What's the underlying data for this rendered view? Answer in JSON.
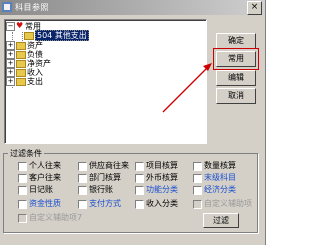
{
  "window": {
    "title": "科目参照",
    "close_glyph": "×"
  },
  "tree": {
    "root": "常用",
    "selected": "504 其他支出",
    "items": [
      "资产",
      "负债",
      "净资产",
      "收入",
      "支出"
    ]
  },
  "buttons": {
    "ok": "确定",
    "common": "常用",
    "edit": "编辑",
    "cancel": "取消"
  },
  "filter": {
    "title": "过滤条件",
    "row1": [
      "个人往来",
      "供应商往来",
      "项目核算",
      "数量核算"
    ],
    "row2": [
      "客户往来",
      "部门核算",
      "外币核算",
      "末级科目"
    ],
    "row3": [
      "日记账",
      "银行账",
      "功能分类",
      "经济分类"
    ],
    "row4": [
      "资金性质",
      "支付方式",
      "收入分类",
      "自定义辅助项"
    ],
    "row5": [
      "自定义辅助项7"
    ],
    "filter_button": "过滤"
  },
  "colors": {
    "accent_blue": "#1a4fd0",
    "highlight_red": "#cc0000",
    "selection": "#0a246a"
  }
}
